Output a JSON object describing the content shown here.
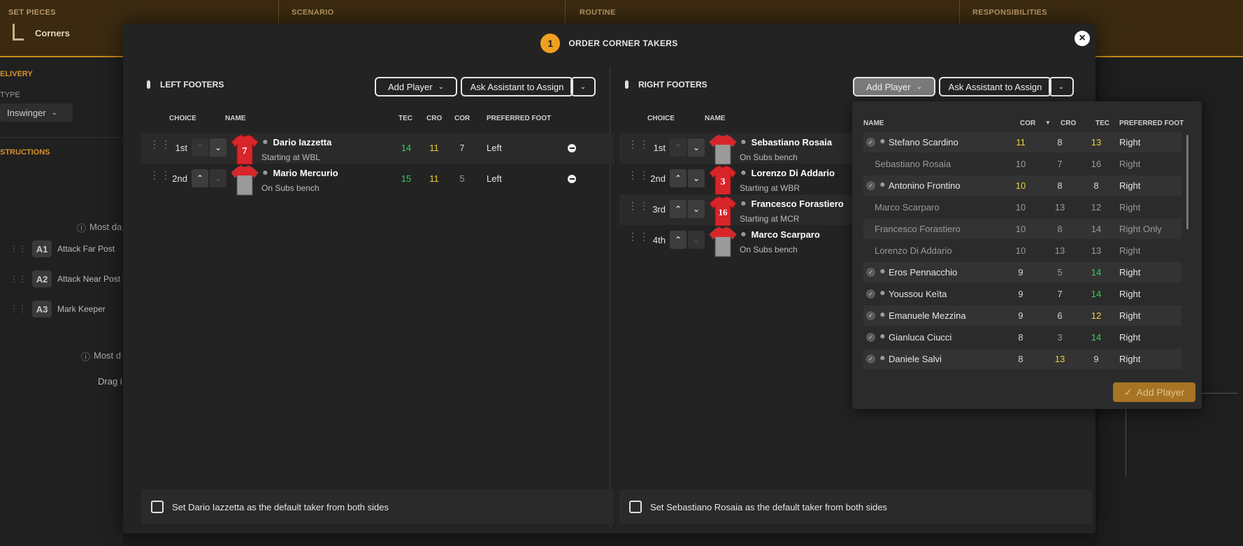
{
  "topbar": {
    "set_pieces_label": "SET PIECES",
    "set_pieces_value": "Corners",
    "scenario_label": "SCENARIO",
    "routine_label": "ROUTINE",
    "responsibilities_label": "RESPONSIBILITIES"
  },
  "sidebar": {
    "delivery_label": "ELIVERY",
    "type_label": "TYPE",
    "type_value": "Inswinger",
    "instructions_label": "STRUCTIONS",
    "most_da_1": "Most da",
    "most_da_2": "Most d",
    "drag_text": "Drag i",
    "routines": [
      {
        "badge": "A1",
        "label": "Attack Far Post"
      },
      {
        "badge": "A2",
        "label": "Attack Near Post"
      },
      {
        "badge": "A3",
        "label": "Mark Keeper"
      }
    ]
  },
  "modal": {
    "step": "1",
    "title": "ORDER CORNER TAKERS",
    "close_icon": "close-icon"
  },
  "left": {
    "title": "LEFT FOOTERS",
    "add_player": "Add Player",
    "ask_assistant": "Ask Assistant to Assign",
    "columns": {
      "choice": "CHOICE",
      "name": "NAME",
      "tec": "TEC",
      "cro": "CRO",
      "cor": "COR",
      "foot": "PREFERRED FOOT"
    },
    "players": [
      {
        "order": "1st",
        "number": "7",
        "name": "Dario Iazzetta",
        "status": "Starting at WBL",
        "tec": "14",
        "cro": "11",
        "cor": "7",
        "foot": "Left",
        "kit": "red"
      },
      {
        "order": "2nd",
        "number": "",
        "name": "Mario Mercurio",
        "status": "On Subs bench",
        "tec": "15",
        "cro": "11",
        "cor": "5",
        "foot": "Left",
        "kit": "grey"
      }
    ],
    "default_text": "Set Dario Iazzetta as the default taker from both sides"
  },
  "right": {
    "title": "RIGHT FOOTERS",
    "add_player": "Add Player",
    "ask_assistant": "Ask Assistant to Assign",
    "columns": {
      "choice": "CHOICE",
      "name": "NAME"
    },
    "players": [
      {
        "order": "1st",
        "number": "",
        "name": "Sebastiano Rosaia",
        "status": "On Subs bench",
        "kit": "grey"
      },
      {
        "order": "2nd",
        "number": "3",
        "name": "Lorenzo Di Addario",
        "status": "Starting at WBR",
        "kit": "red"
      },
      {
        "order": "3rd",
        "number": "16",
        "name": "Francesco Forastiero",
        "status": "Starting at MCR",
        "kit": "red"
      },
      {
        "order": "4th",
        "number": "",
        "name": "Marco Scarparo",
        "status": "On Subs bench",
        "kit": "grey"
      }
    ],
    "default_text": "Set Sebastiano Rosaia as the default taker from both sides"
  },
  "dropdown": {
    "columns": {
      "name": "NAME",
      "cor": "COR",
      "cro": "CRO",
      "tec": "TEC",
      "foot": "PREFERRED FOOT"
    },
    "rows": [
      {
        "name": "Stefano Scardino",
        "cor": "11",
        "cro": "8",
        "tec": "13",
        "foot": "Right",
        "avail": true
      },
      {
        "name": "Sebastiano Rosaia",
        "cor": "10",
        "cro": "7",
        "tec": "16",
        "foot": "Right",
        "avail": false
      },
      {
        "name": "Antonino Frontino",
        "cor": "10",
        "cro": "8",
        "tec": "8",
        "foot": "Right",
        "avail": true
      },
      {
        "name": "Marco Scarparo",
        "cor": "10",
        "cro": "13",
        "tec": "12",
        "foot": "Right",
        "avail": false
      },
      {
        "name": "Francesco Forastiero",
        "cor": "10",
        "cro": "8",
        "tec": "14",
        "foot": "Right Only",
        "avail": false
      },
      {
        "name": "Lorenzo Di Addario",
        "cor": "10",
        "cro": "13",
        "tec": "13",
        "foot": "Right",
        "avail": false
      },
      {
        "name": "Eros Pennacchio",
        "cor": "9",
        "cro": "5",
        "tec": "14",
        "foot": "Right",
        "avail": true
      },
      {
        "name": "Youssou Keïta",
        "cor": "9",
        "cro": "7",
        "tec": "14",
        "foot": "Right",
        "avail": true
      },
      {
        "name": "Emanuele Mezzina",
        "cor": "9",
        "cro": "6",
        "tec": "12",
        "foot": "Right",
        "avail": true
      },
      {
        "name": "Gianluca Ciucci",
        "cor": "8",
        "cro": "3",
        "tec": "14",
        "foot": "Right",
        "avail": true
      },
      {
        "name": "Daniele Salvi",
        "cor": "8",
        "cro": "13",
        "tec": "9",
        "foot": "Right",
        "avail": true
      }
    ],
    "add_button": "Add Player"
  },
  "colors": {
    "accent": "#f0a020",
    "green": "#34d058",
    "yellow": "#e8d33a"
  }
}
